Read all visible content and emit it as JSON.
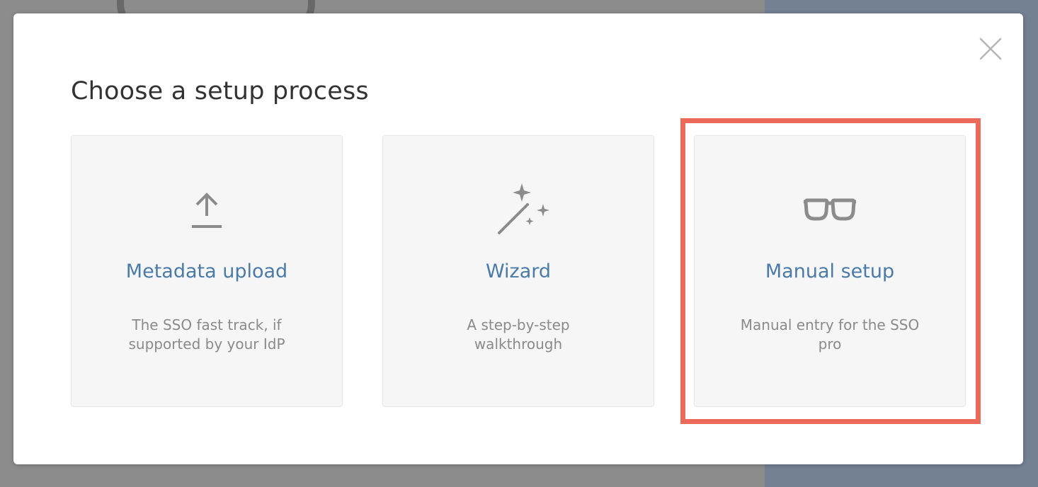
{
  "modal": {
    "title": "Choose a setup process",
    "close_icon": "close-icon"
  },
  "options": [
    {
      "title": "Metadata upload",
      "description": "The SSO fast track, if supported by your IdP",
      "icon": "upload-icon"
    },
    {
      "title": "Wizard",
      "description": "A step-by-step walkthrough",
      "icon": "magic-wand-icon"
    },
    {
      "title": "Manual setup",
      "description": "Manual entry for the SSO pro",
      "icon": "glasses-icon"
    }
  ],
  "highlight": {
    "target": "Manual setup",
    "color": "#ec6a5a"
  },
  "colors": {
    "title_link": "#4a7ba8",
    "description": "#8a8a8a",
    "card_bg": "#f6f6f6",
    "icon": "#8c8c8c"
  }
}
